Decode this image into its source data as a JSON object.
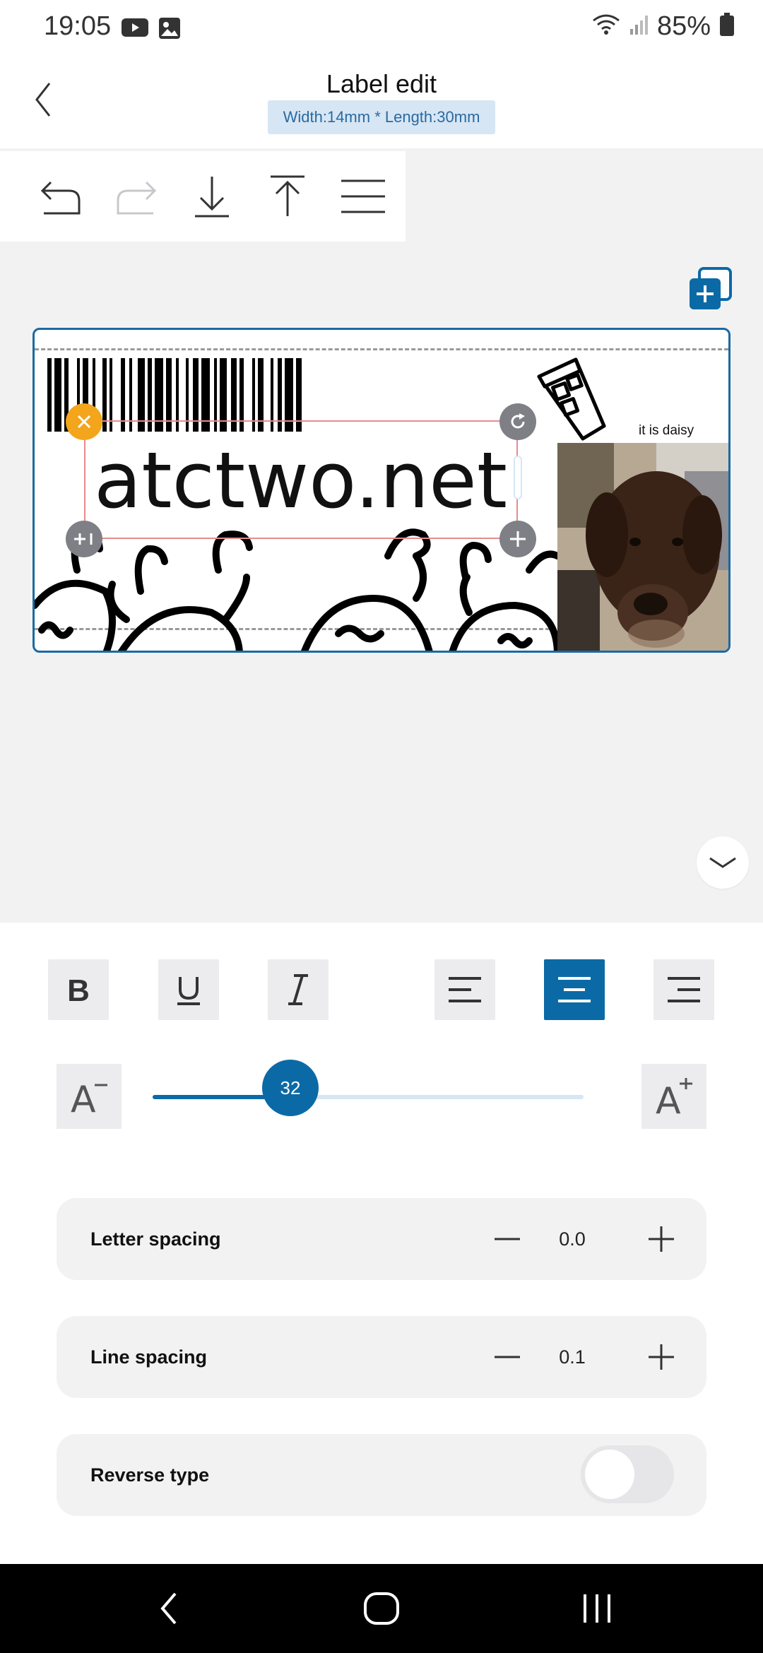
{
  "status_bar": {
    "time": "19:05",
    "battery_text": "85%",
    "icons": [
      "youtube-icon",
      "gallery-icon",
      "wifi-icon",
      "signal-icon",
      "battery-icon"
    ]
  },
  "header": {
    "title": "Label edit",
    "dimensions": "Width:14mm * Length:30mm",
    "back_icon": "back-chevron-icon"
  },
  "toolbar": {
    "icons": [
      "undo-icon",
      "redo-icon",
      "download-icon",
      "upload-icon",
      "menu-icon"
    ]
  },
  "label": {
    "text": "atctwo.net",
    "caption": "it is daisy"
  },
  "format": {
    "buttons": [
      "bold-icon",
      "underline-icon",
      "italic-icon",
      "align-left-icon",
      "align-center-icon",
      "align-right-icon"
    ],
    "active_alignment": "center"
  },
  "font_size": {
    "value": "32",
    "slider_fraction": 0.32,
    "decrease_label": "A",
    "increase_label": "A"
  },
  "letter_spacing": {
    "label": "Letter spacing",
    "value": "0.0"
  },
  "line_spacing": {
    "label": "Line spacing",
    "value": "0.1"
  },
  "reverse_type": {
    "label": "Reverse type",
    "enabled": false
  },
  "colors": {
    "accent": "#0b6aa6",
    "handle_close": "#f3a51c",
    "handle_gray": "#7e8086",
    "chip_bg": "#d7e6f4"
  }
}
